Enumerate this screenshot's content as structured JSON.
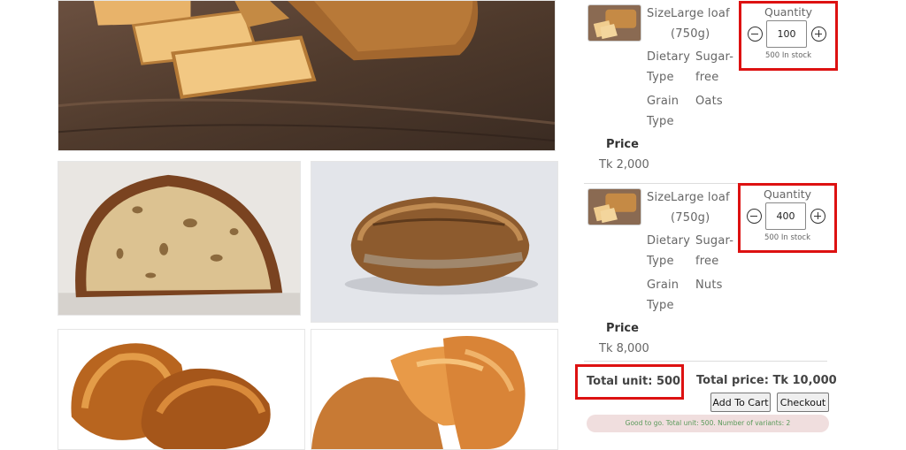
{
  "gallery": {
    "images": [
      {
        "name": "sliced-loaf-on-board"
      },
      {
        "name": "sourdough-cross-section"
      },
      {
        "name": "rustic-bread-loaf"
      },
      {
        "name": "croissants"
      },
      {
        "name": "bread-rolls"
      }
    ]
  },
  "variants": [
    {
      "size_label": "Size",
      "size_value_line1": "Large loaf",
      "size_value_line2": "(750g)",
      "dietary_label_line1": "Dietary",
      "dietary_label_line2": "Type",
      "dietary_value_line1": "Sugar-",
      "dietary_value_line2": "free",
      "grain_label_line1": "Grain",
      "grain_label_line2": "Type",
      "grain_value": "Oats",
      "price_label": "Price",
      "price_value": "Tk 2,000",
      "quantity_title": "Quantity",
      "quantity": "100",
      "stock": "500 In stock"
    },
    {
      "size_label": "Size",
      "size_value_line1": "Large loaf",
      "size_value_line2": "(750g)",
      "dietary_label_line1": "Dietary",
      "dietary_label_line2": "Type",
      "dietary_value_line1": "Sugar-",
      "dietary_value_line2": "free",
      "grain_label_line1": "Grain",
      "grain_label_line2": "Type",
      "grain_value": "Nuts",
      "price_label": "Price",
      "price_value": "Tk 8,000",
      "quantity_title": "Quantity",
      "quantity": "400",
      "stock": "500 In stock"
    }
  ],
  "summary": {
    "total_unit": "Total unit: 500",
    "total_price": "Total price:  Tk 10,000",
    "add_to_cart_label": "Add To Cart",
    "checkout_label": "Checkout",
    "status_message": "Good to go. Total unit: 500. Number of variants: 2"
  },
  "colors": {
    "highlight_border": "#dd1111",
    "status_bg": "#f0dede",
    "status_text": "#5a9a5a"
  }
}
